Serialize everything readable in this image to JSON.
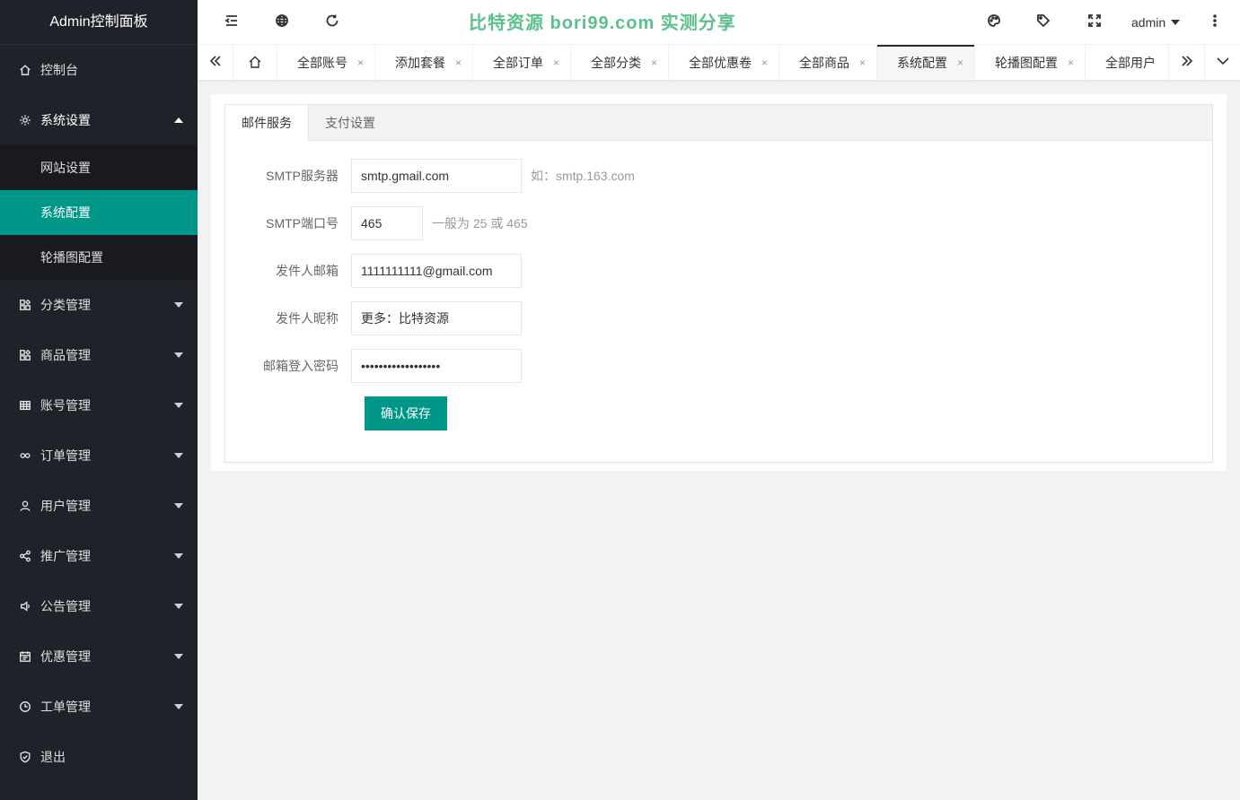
{
  "sidebar": {
    "logo": "Admin控制面板",
    "dashboard": "控制台",
    "system_settings": "系统设置",
    "sub_items": [
      "网站设置",
      "系统配置",
      "轮播图配置"
    ],
    "menus": [
      "分类管理",
      "商品管理",
      "账号管理",
      "订单管理",
      "用户管理",
      "推广管理",
      "公告管理",
      "优惠管理",
      "工单管理"
    ],
    "logout": "退出"
  },
  "header": {
    "watermark": "比特资源 bori99.com 实测分享",
    "user": "admin"
  },
  "tabs": [
    {
      "label": "全部账号"
    },
    {
      "label": "添加套餐"
    },
    {
      "label": "全部订单"
    },
    {
      "label": "全部分类"
    },
    {
      "label": "全部优惠卷"
    },
    {
      "label": "全部商品"
    },
    {
      "label": "系统配置"
    },
    {
      "label": "轮播图配置"
    },
    {
      "label": "全部用户"
    }
  ],
  "tab_close": "×",
  "card_tabs": [
    "邮件服务",
    "支付设置"
  ],
  "form": {
    "smtp_server_label": "SMTP服务器",
    "smtp_server_value": "smtp.gmail.com",
    "smtp_server_hint": "如：smtp.163.com",
    "smtp_port_label": "SMTP端口号",
    "smtp_port_value": "465",
    "smtp_port_hint": "一般为 25 或 465",
    "sender_email_label": "发件人邮箱",
    "sender_email_value": "1111111111@gmail.com",
    "sender_name_label": "发件人昵称",
    "sender_name_value": "更多：比特资源",
    "password_label": "邮箱登入密码",
    "password_value": "••••••••••••••••••",
    "save_label": "确认保存"
  },
  "colors": {
    "sidebar_bg": "#20222a",
    "accent": "#009688",
    "watermark": "#5cc08e"
  }
}
